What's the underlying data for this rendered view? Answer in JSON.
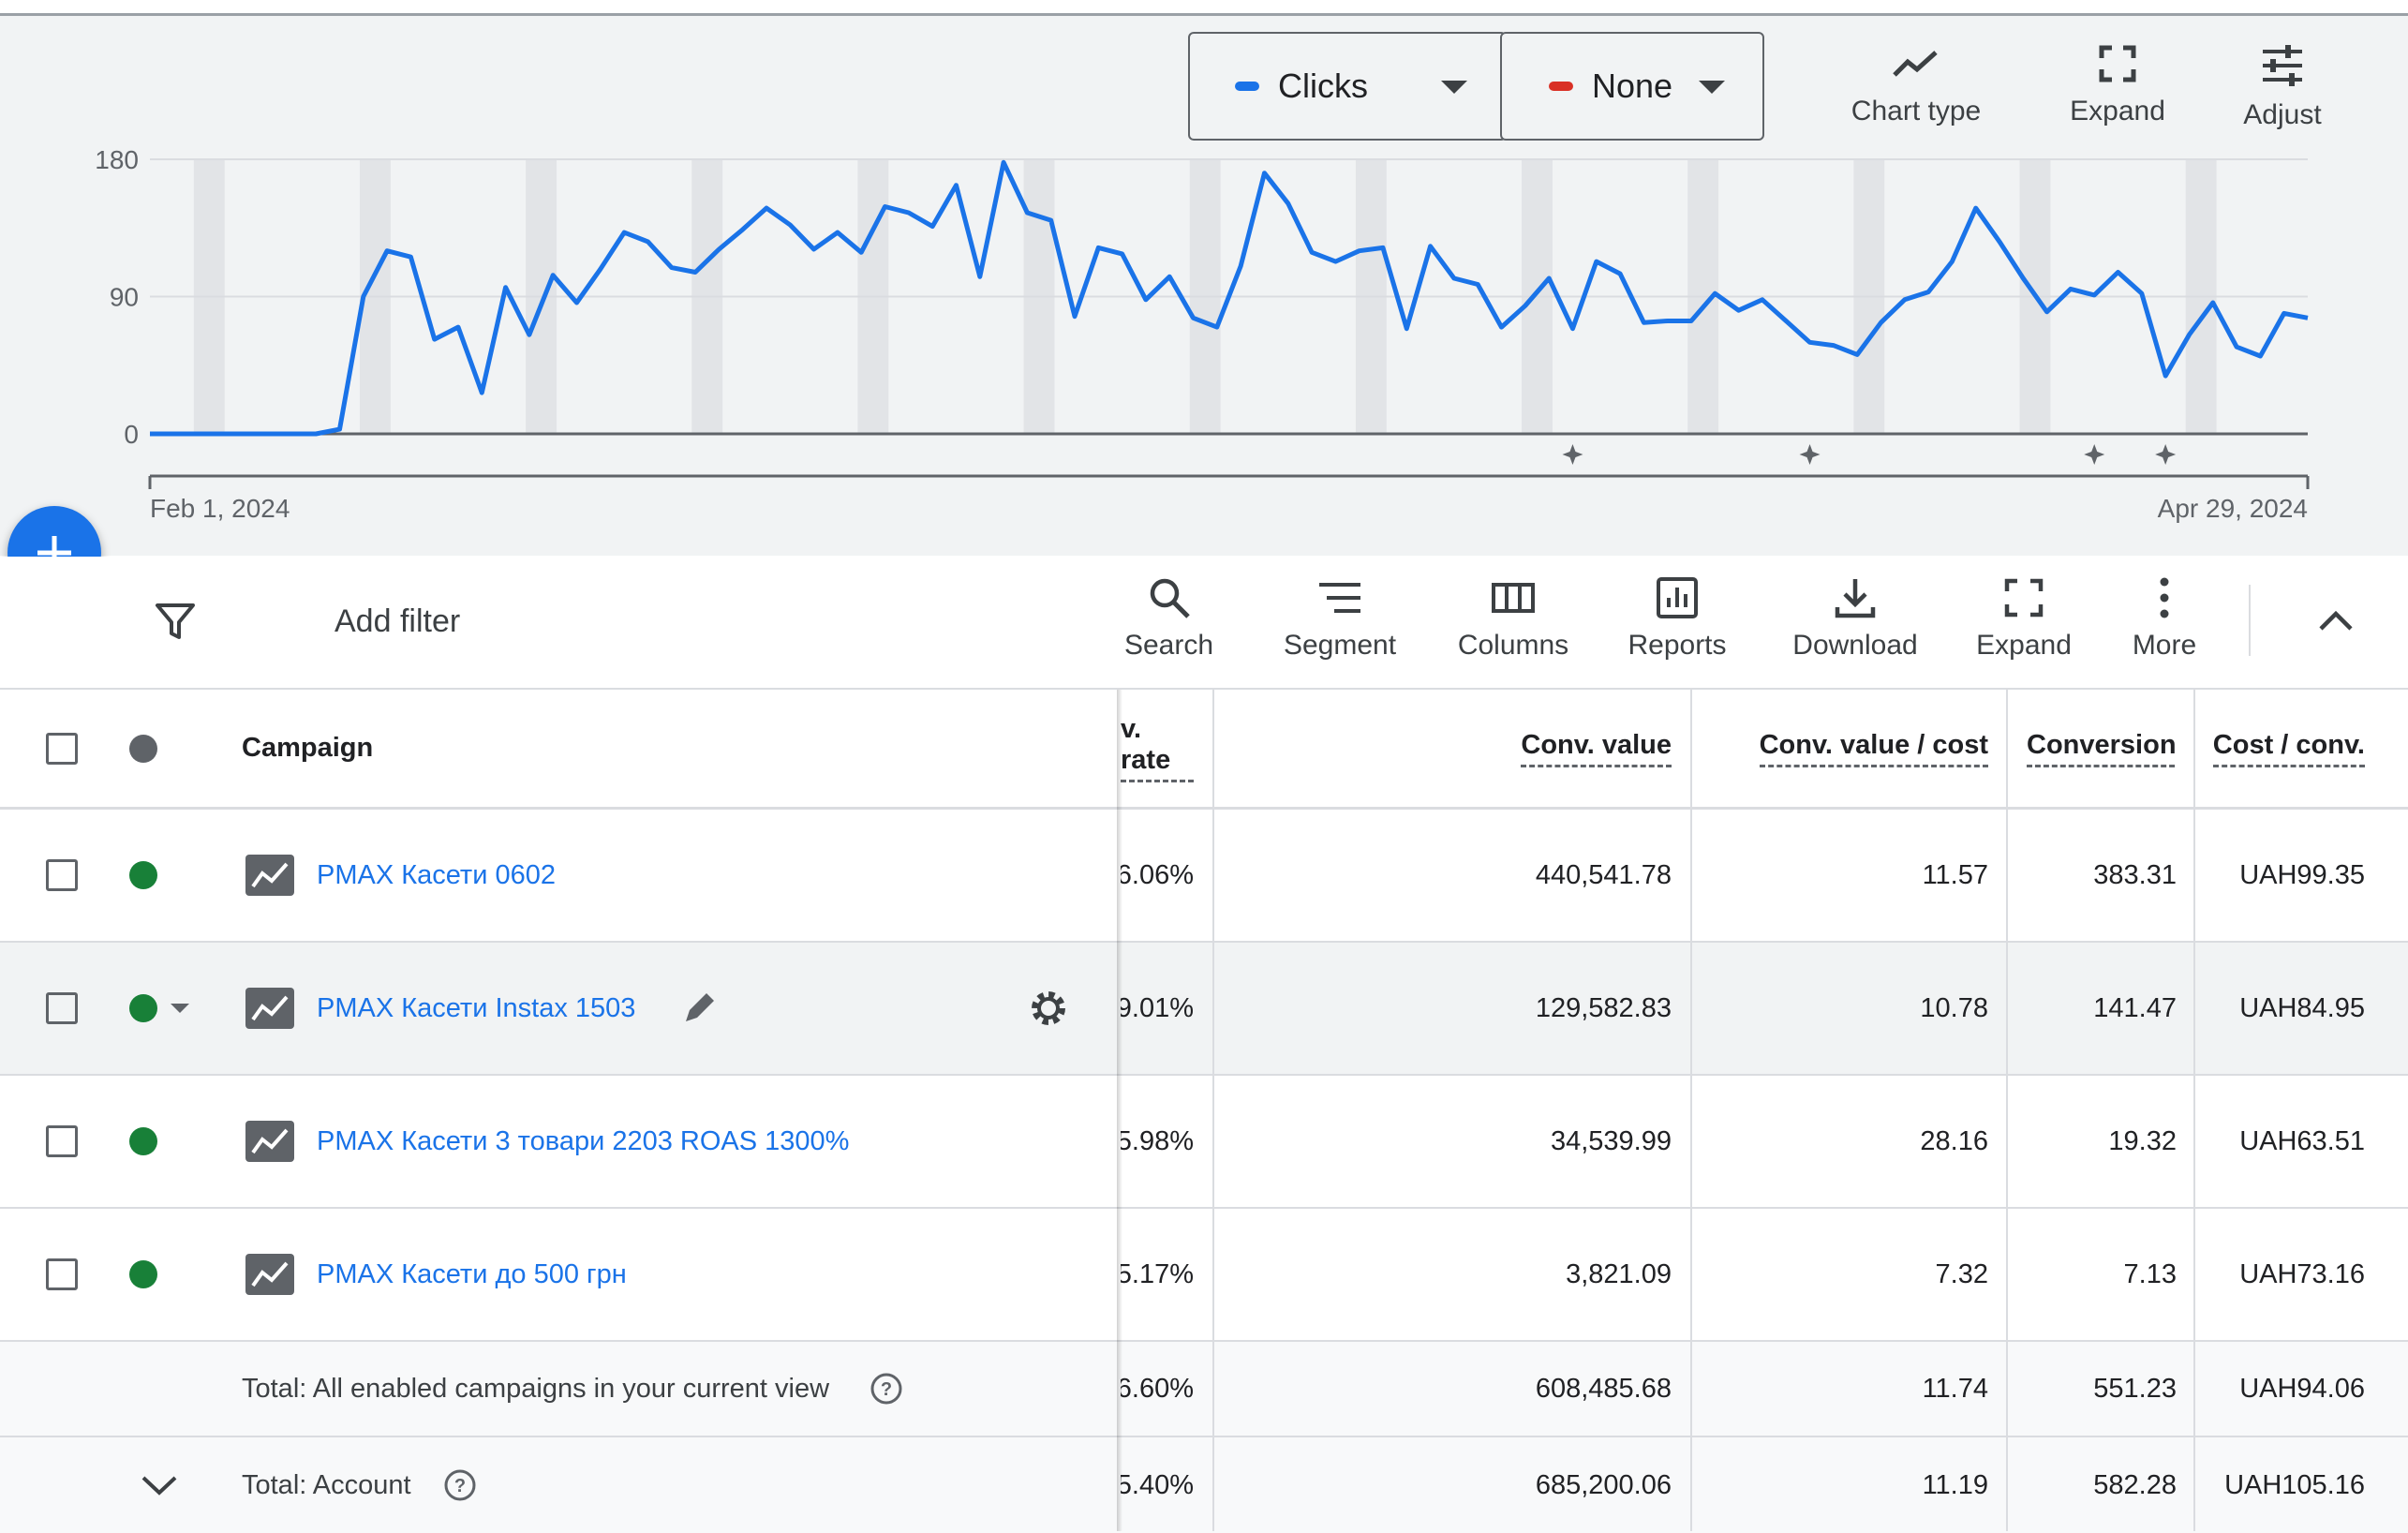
{
  "chart_controls": {
    "primary_metric": "Clicks",
    "primary_color": "#1a73e8",
    "secondary_metric": "None",
    "secondary_color": "#d93025",
    "tools": [
      {
        "label": "Chart type",
        "icon": "line-chart-icon"
      },
      {
        "label": "Expand",
        "icon": "expand-icon"
      },
      {
        "label": "Adjust",
        "icon": "tune-icon"
      }
    ]
  },
  "chart_data": {
    "type": "line",
    "x_start_label": "Feb 1, 2024",
    "x_end_label": "Apr 29, 2024",
    "y_ticks": [
      "180",
      "90",
      "0"
    ],
    "ylim": [
      0,
      180
    ],
    "series": [
      {
        "color": "#1a73e8",
        "values": [
          0,
          0,
          0,
          0,
          0,
          0,
          0,
          0,
          3,
          90,
          120,
          116,
          62,
          70,
          27,
          96,
          65,
          104,
          86,
          108,
          132,
          126,
          109,
          106,
          121,
          134,
          148,
          137,
          121,
          132,
          119,
          149,
          145,
          136,
          163,
          103,
          178,
          145,
          140,
          77,
          122,
          118,
          88,
          103,
          76,
          70,
          110,
          171,
          151,
          119,
          113,
          120,
          122,
          69,
          123,
          102,
          98,
          70,
          84,
          102,
          69,
          113,
          105,
          73,
          74,
          74,
          92,
          81,
          88,
          74,
          60,
          58,
          52,
          73,
          88,
          93,
          113,
          148,
          126,
          102,
          80,
          95,
          91,
          106,
          92,
          38,
          65,
          86,
          57,
          51,
          79,
          76
        ]
      }
    ],
    "grid": true,
    "legend": "none"
  },
  "toolbar": {
    "add_filter": "Add filter",
    "items": [
      {
        "label": "Search",
        "icon": "search-icon"
      },
      {
        "label": "Segment",
        "icon": "segment-icon"
      },
      {
        "label": "Columns",
        "icon": "columns-icon"
      },
      {
        "label": "Reports",
        "icon": "reports-icon"
      },
      {
        "label": "Download",
        "icon": "download-icon"
      },
      {
        "label": "Expand",
        "icon": "expand-icon"
      },
      {
        "label": "More",
        "icon": "more-vert-icon"
      }
    ]
  },
  "table": {
    "headers": {
      "campaign": "Campaign",
      "conv_rate": "v. rate",
      "conv_value": "Conv. value",
      "conv_value_cost": "Conv. value / cost",
      "conversions": "Conversions",
      "cost_conv": "Cost / conv."
    },
    "rows": [
      {
        "campaign": "PMAX Касети 0602",
        "conv_rate": "6.06%",
        "conv_value": "440,541.78",
        "conv_value_cost": "11.57",
        "conversions": "383.31",
        "cost_conv": "UAH99.35"
      },
      {
        "campaign": "PMAX Касети Instax 1503",
        "conv_rate": "9.01%",
        "conv_value": "129,582.83",
        "conv_value_cost": "10.78",
        "conversions": "141.47",
        "cost_conv": "UAH84.95"
      },
      {
        "campaign": "PMAX Касети 3 товари 2203 ROAS 1300%",
        "conv_rate": "5.98%",
        "conv_value": "34,539.99",
        "conv_value_cost": "28.16",
        "conversions": "19.32",
        "cost_conv": "UAH63.51"
      },
      {
        "campaign": "PMAX Касети до 500 грн",
        "conv_rate": "5.17%",
        "conv_value": "3,821.09",
        "conv_value_cost": "7.32",
        "conversions": "7.13",
        "cost_conv": "UAH73.16"
      }
    ],
    "totals": [
      {
        "label": "Total: All enabled campaigns in your current view",
        "conv_rate": "6.60%",
        "conv_value": "608,485.68",
        "conv_value_cost": "11.74",
        "conversions": "551.23",
        "cost_conv": "UAH94.06"
      },
      {
        "label": "Total: Account",
        "conv_rate": "5.40%",
        "conv_value": "685,200.06",
        "conv_value_cost": "11.19",
        "conversions": "582.28",
        "cost_conv": "UAH105.16"
      }
    ]
  }
}
